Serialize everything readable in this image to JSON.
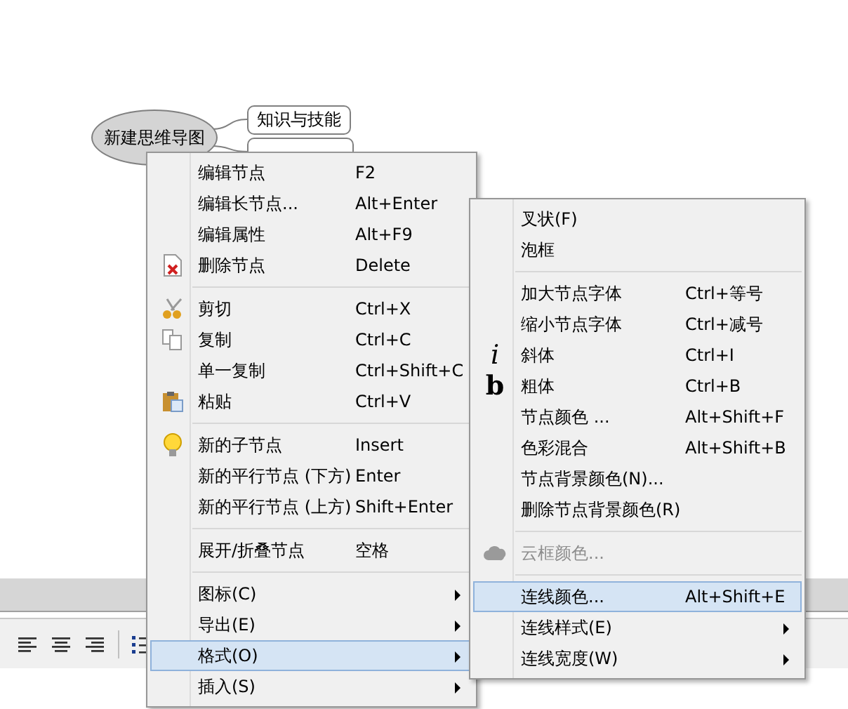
{
  "canvas": {
    "root_node": "新建思维导图",
    "child_nodes": [
      "知识与技能"
    ]
  },
  "context_menu": {
    "groups": [
      [
        {
          "label": "编辑节点",
          "shortcut": "F2",
          "kind": "plain",
          "has_submenu": false,
          "selected": false,
          "disabled": false
        },
        {
          "label": "编辑长节点...",
          "shortcut": "Alt+Enter",
          "kind": "plain",
          "has_submenu": false,
          "selected": false,
          "disabled": false
        },
        {
          "label": "编辑属性",
          "shortcut": "Alt+F9",
          "kind": "plain",
          "has_submenu": false,
          "selected": false,
          "disabled": false
        },
        {
          "label": "删除节点",
          "shortcut": "Delete",
          "kind": "delete",
          "has_submenu": false,
          "selected": false,
          "disabled": false
        }
      ],
      [
        {
          "label": "剪切",
          "shortcut": "Ctrl+X",
          "kind": "cut",
          "has_submenu": false,
          "selected": false,
          "disabled": false
        },
        {
          "label": "复制",
          "shortcut": "Ctrl+C",
          "kind": "copy",
          "has_submenu": false,
          "selected": false,
          "disabled": false
        },
        {
          "label": "单一复制",
          "shortcut": "Ctrl+Shift+C",
          "kind": "plain",
          "has_submenu": false,
          "selected": false,
          "disabled": false
        },
        {
          "label": "粘贴",
          "shortcut": "Ctrl+V",
          "kind": "paste",
          "has_submenu": false,
          "selected": false,
          "disabled": false
        }
      ],
      [
        {
          "label": "新的子节点",
          "shortcut": "Insert",
          "kind": "bulb",
          "has_submenu": false,
          "selected": false,
          "disabled": false
        },
        {
          "label": "新的平行节点 (下方)",
          "shortcut": "Enter",
          "kind": "plain",
          "has_submenu": false,
          "selected": false,
          "disabled": false
        },
        {
          "label": "新的平行节点 (上方)",
          "shortcut": "Shift+Enter",
          "kind": "plain",
          "has_submenu": false,
          "selected": false,
          "disabled": false
        }
      ],
      [
        {
          "label": "展开/折叠节点",
          "shortcut": "空格",
          "kind": "plain",
          "has_submenu": false,
          "selected": false,
          "disabled": false
        }
      ],
      [
        {
          "label": "图标(C)",
          "kind": "plain",
          "has_submenu": true,
          "selected": false,
          "disabled": false
        },
        {
          "label": "导出(E)",
          "kind": "plain",
          "has_submenu": true,
          "selected": false,
          "disabled": false
        },
        {
          "label": "格式(O)",
          "kind": "plain",
          "has_submenu": true,
          "selected": true,
          "disabled": false
        },
        {
          "label": "插入(S)",
          "kind": "plain",
          "has_submenu": true,
          "selected": false,
          "disabled": false
        }
      ]
    ]
  },
  "format_submenu": {
    "groups": [
      [
        {
          "label": "叉状(F)",
          "kind": "plain",
          "has_submenu": false,
          "selected": false,
          "disabled": false
        },
        {
          "label": "泡框",
          "kind": "plain",
          "has_submenu": false,
          "selected": false,
          "disabled": false
        }
      ],
      [
        {
          "label": "加大节点字体",
          "shortcut": "Ctrl+等号",
          "kind": "plain",
          "has_submenu": false,
          "selected": false,
          "disabled": false
        },
        {
          "label": "缩小节点字体",
          "shortcut": "Ctrl+减号",
          "kind": "plain",
          "has_submenu": false,
          "selected": false,
          "disabled": false
        },
        {
          "label": "斜体",
          "shortcut": "Ctrl+I",
          "kind": "italic-glyph",
          "glyph": "i",
          "has_submenu": false,
          "selected": false,
          "disabled": false
        },
        {
          "label": "粗体",
          "shortcut": "Ctrl+B",
          "kind": "bold-glyph",
          "glyph": "b",
          "has_submenu": false,
          "selected": false,
          "disabled": false
        },
        {
          "label": "节点颜色 ...",
          "shortcut": "Alt+Shift+F",
          "kind": "plain",
          "has_submenu": false,
          "selected": false,
          "disabled": false
        },
        {
          "label": "色彩混合",
          "shortcut": "Alt+Shift+B",
          "kind": "plain",
          "has_submenu": false,
          "selected": false,
          "disabled": false
        },
        {
          "label": "节点背景颜色(N)...",
          "kind": "plain",
          "has_submenu": false,
          "selected": false,
          "disabled": false
        },
        {
          "label": "删除节点背景颜色(R)",
          "kind": "plain",
          "has_submenu": false,
          "selected": false,
          "disabled": false
        }
      ],
      [
        {
          "label": "云框颜色...",
          "kind": "cloud",
          "has_submenu": false,
          "selected": false,
          "disabled": true
        }
      ],
      [
        {
          "label": "连线颜色...",
          "shortcut": "Alt+Shift+E",
          "kind": "plain",
          "has_submenu": false,
          "selected": true,
          "disabled": false
        },
        {
          "label": "连线样式(E)",
          "kind": "plain",
          "has_submenu": true,
          "selected": false,
          "disabled": false
        },
        {
          "label": "连线宽度(W)",
          "kind": "plain",
          "has_submenu": true,
          "selected": false,
          "disabled": false
        }
      ]
    ]
  }
}
